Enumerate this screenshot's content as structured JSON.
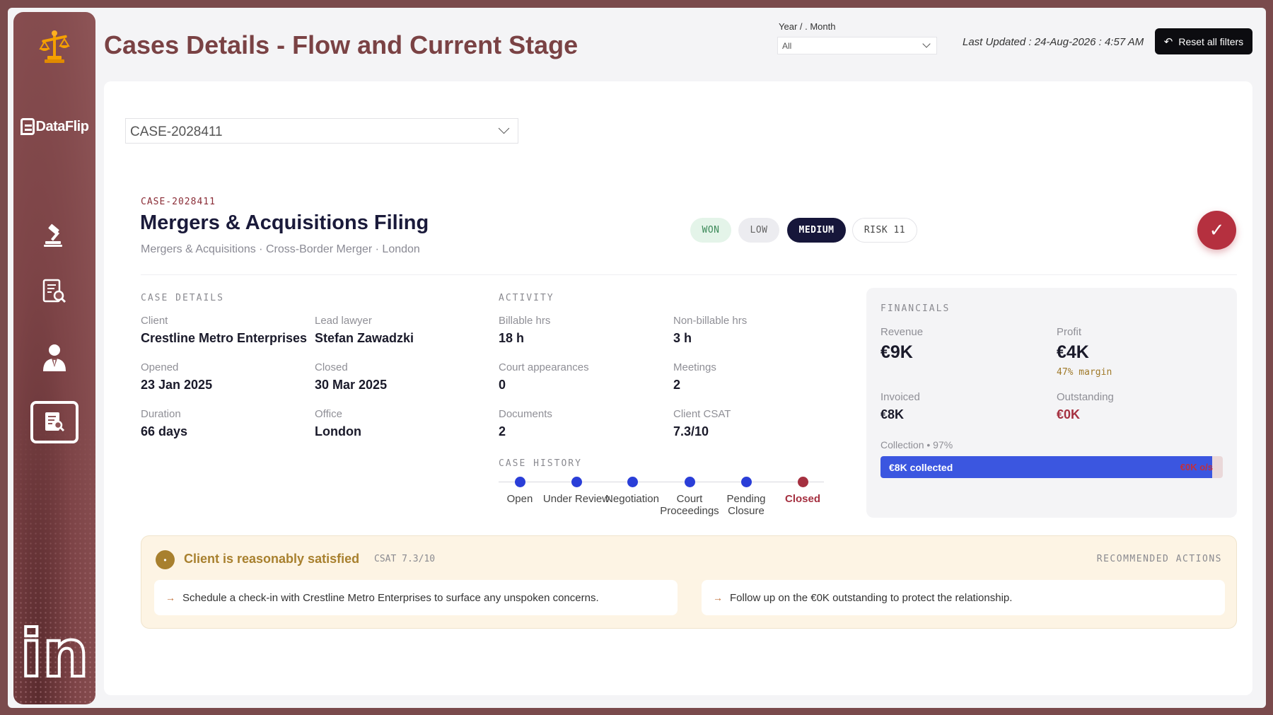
{
  "header": {
    "title": "Cases Details - Flow and Current Stage",
    "filter_label": "Year / . Month",
    "filter_value": "All",
    "last_updated": "Last Updated : 24-Aug-2026 : 4:57 AM",
    "reset_label": "Reset all filters"
  },
  "sidebar": {
    "logo_text": "DataFlip",
    "linkedin_text": "in",
    "items": [
      {
        "icon": "gavel-icon"
      },
      {
        "icon": "document-search-icon"
      },
      {
        "icon": "lawyer-icon"
      },
      {
        "icon": "case-report-icon",
        "active": true
      }
    ]
  },
  "case_selector": {
    "value": "CASE-2028411"
  },
  "case": {
    "code": "CASE-2028411",
    "title": "Mergers & Acquisitions Filing",
    "subtitle": "Mergers & Acquisitions · Cross-Border Merger · London",
    "pills": {
      "outcome": "WON",
      "low": "LOW",
      "medium": "MEDIUM",
      "risk": "RISK 11"
    }
  },
  "details": {
    "label": "CASE DETAILS",
    "client_k": "Client",
    "client_v": "Crestline Metro Enterprises",
    "lawyer_k": "Lead lawyer",
    "lawyer_v": "Stefan Zawadzki",
    "opened_k": "Opened",
    "opened_v": "23 Jan 2025",
    "closed_k": "Closed",
    "closed_v": "30 Mar 2025",
    "duration_k": "Duration",
    "duration_v": "66 days",
    "office_k": "Office",
    "office_v": "London"
  },
  "activity": {
    "label": "ACTIVITY",
    "billable_k": "Billable hrs",
    "billable_v": "18 h",
    "nonbill_k": "Non-billable hrs",
    "nonbill_v": "3 h",
    "court_k": "Court appearances",
    "court_v": "0",
    "meetings_k": "Meetings",
    "meetings_v": "2",
    "docs_k": "Documents",
    "docs_v": "2",
    "csat_k": "Client CSAT",
    "csat_v": "7.3/10"
  },
  "history": {
    "label": "CASE HISTORY",
    "steps": [
      "Open",
      "Under Review",
      "Negotiation",
      "Court Proceedings",
      "Pending Closure",
      "Closed"
    ],
    "current": "Closed"
  },
  "financials": {
    "label": "FINANCIALS",
    "revenue_k": "Revenue",
    "revenue_v": "€9K",
    "profit_k": "Profit",
    "profit_v": "€4K",
    "margin": "47% margin",
    "invoiced_k": "Invoiced",
    "invoiced_v": "€8K",
    "outstanding_k": "Outstanding",
    "outstanding_v": "€0K",
    "collection_label": "Collection • 97%",
    "collection_fraction": 0.97,
    "collected_text": "€8K collected",
    "outstanding_text": "€0K o/s"
  },
  "banner": {
    "icon": "•",
    "title": "Client is reasonably satisfied",
    "csat": "CSAT 7.3/10",
    "rec_label": "RECOMMENDED ACTIONS",
    "actions": [
      "Schedule a check-in with Crestline Metro Enterprises to surface any unspoken concerns.",
      "Follow up on the €0K outstanding to protect the relationship."
    ]
  },
  "colors": {
    "accent_maroon": "#7a4244",
    "progress_blue": "#3b56e0",
    "danger": "#b5303f",
    "satisfaction_gold": "#a8802e"
  }
}
